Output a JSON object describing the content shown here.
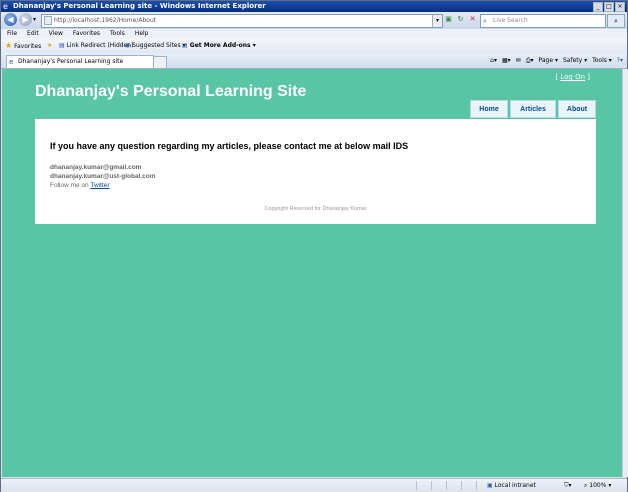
{
  "window": {
    "title": "Dhananjay's Personal Learning site - Windows Internet Explorer",
    "controls": [
      "_",
      "□",
      "×"
    ]
  },
  "browser": {
    "url": "http://localhost:1962/Home/About",
    "search_placeholder": "Live Search",
    "menu": [
      "File",
      "Edit",
      "View",
      "Favorites",
      "Tools",
      "Help"
    ],
    "favorites_label": "Favorites",
    "fav_items": [
      "Link Redirect (Hidden)",
      "Suggested Sites ▾",
      "Get More Add-ons ▾"
    ],
    "tab_title": "Dhananjay's Personal Learning site",
    "command_bar": [
      "Page ▾",
      "Safety ▾",
      "Tools ▾"
    ],
    "status_zone": "Local intranet",
    "status_zoom": "100%",
    "status_protected": "▾"
  },
  "site": {
    "login_bracket_open": "[ ",
    "login_link": "Log On",
    "login_bracket_close": " ]",
    "title": "Dhananjay's Personal Learning Site",
    "menu": [
      "Home",
      "Articles",
      "About"
    ],
    "heading": "If you have any question regarding my articles, please contact me at below mail IDS",
    "emails": [
      "dhananjay.kumar@gmail.com",
      "dhananjay.kumar@ust-global.com"
    ],
    "follow_prefix": "Follow me on ",
    "follow_link": "Twitter",
    "footer": "Copyright Reserved for Dhananjay Kumar"
  },
  "colors": {
    "page_background": "#58c5a4",
    "content_background": "#ffffff",
    "menu_text": "#034aa2"
  }
}
